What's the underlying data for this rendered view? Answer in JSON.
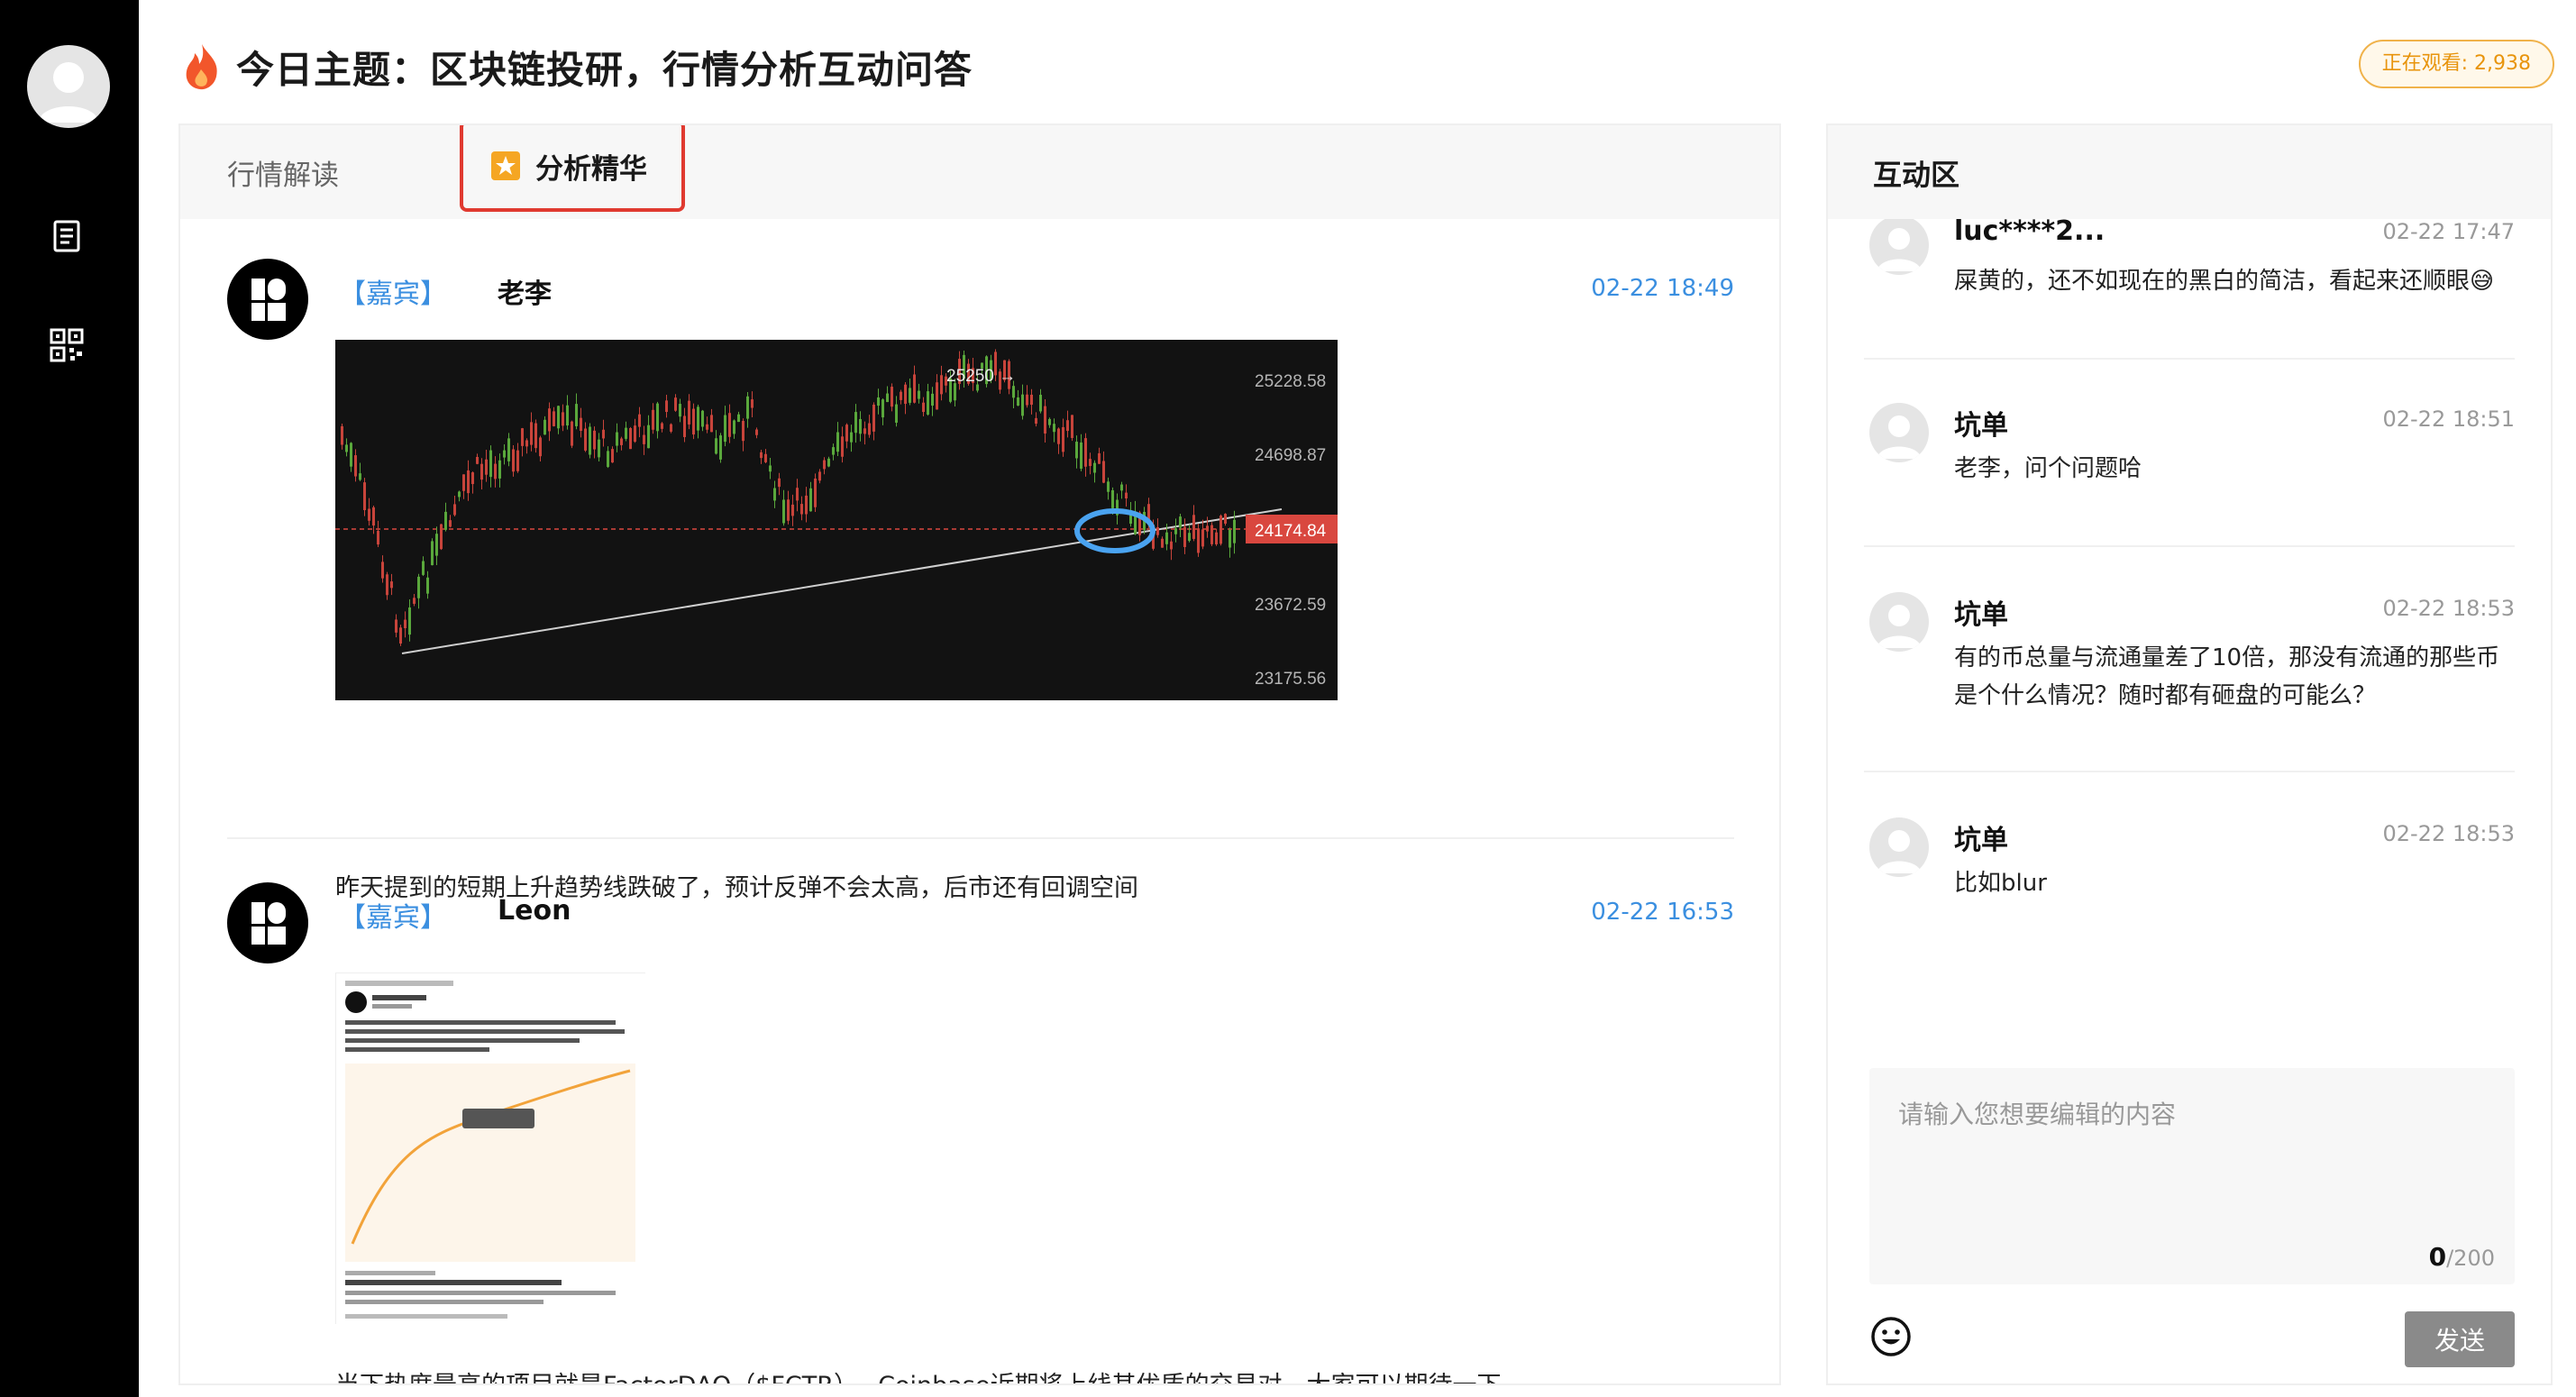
{
  "header": {
    "title": "今日主题：区块链投研，行情分析互动问答",
    "watching": "正在观看: 2,938"
  },
  "tabs": [
    {
      "label": "行情解读"
    },
    {
      "label": "分析精华"
    }
  ],
  "posts": [
    {
      "guest_tag": "【嘉宾】",
      "author": "老李",
      "time": "02-22 18:49",
      "body": "昨天提到的短期上升趋势线跌破了，预计反弹不会太高，后市还有回调空间",
      "chart": {
        "peak_label": "25250 →",
        "price_labels": [
          "25228.58",
          "24698.87",
          "24174.84",
          "23672.59",
          "23175.56"
        ]
      }
    },
    {
      "guest_tag": "【嘉宾】",
      "author": "Leon",
      "time": "02-22 16:53",
      "body": "当下热度最高的项目就是FactorDAO（$FCTR）。 Coinbase近期将上线其优质的交易对，大家可以期待一下"
    }
  ],
  "interaction": {
    "title": "互动区",
    "comments": [
      {
        "user": "luc****2...",
        "time": "02-22 17:47",
        "text": "屎黄的，还不如现在的黑白的简洁，看起来还顺眼😅"
      },
      {
        "user": "坑单",
        "time": "02-22 18:51",
        "text": "老李，问个问题哈"
      },
      {
        "user": "坑单",
        "time": "02-22 18:53",
        "text": "有的币总量与流通量差了10倍，那没有流通的那些币是个什么情况？随时都有砸盘的可能么？"
      },
      {
        "user": "坑单",
        "time": "02-22 18:53",
        "text": "比如blur"
      }
    ],
    "input_placeholder": "请输入您想要编辑的内容",
    "counter_current": "0",
    "counter_max": "/200",
    "send_label": "发送"
  },
  "colors": {
    "accent_blue": "#3b8fe0",
    "highlight_red": "#e03a30",
    "watch_orange": "#e8940c"
  }
}
